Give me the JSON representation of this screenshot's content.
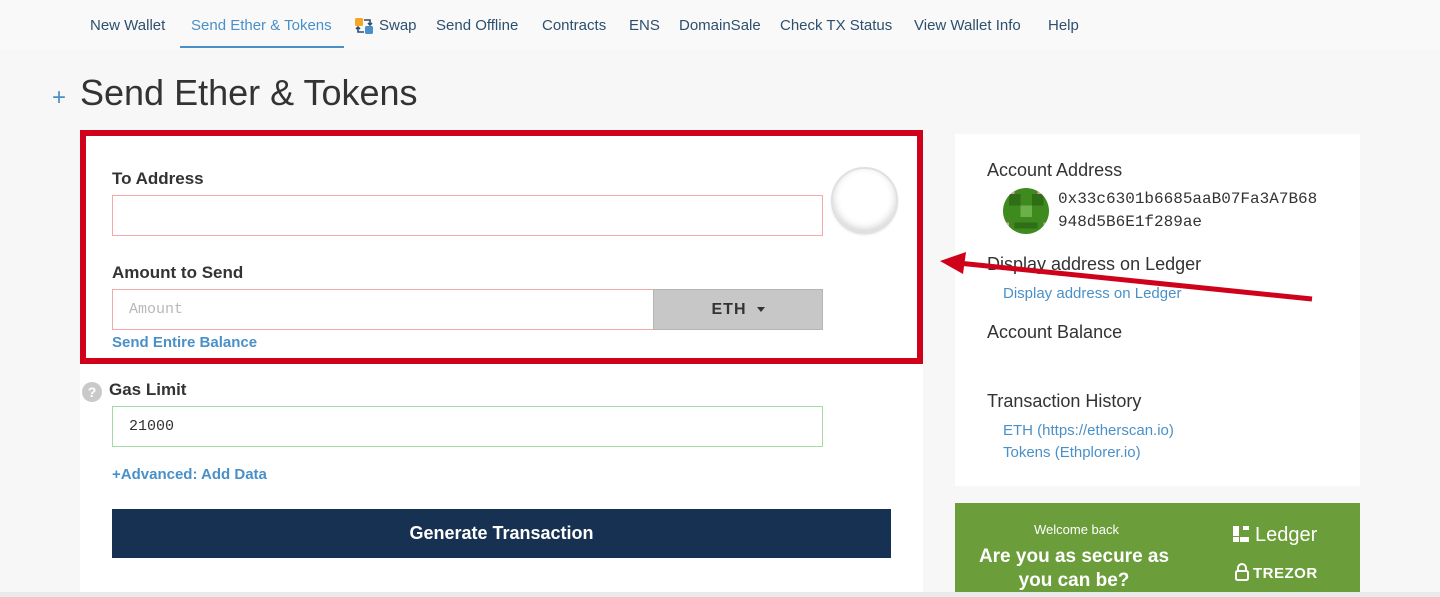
{
  "nav": {
    "items": [
      {
        "label": "New Wallet"
      },
      {
        "label": "Send Ether & Tokens"
      },
      {
        "label": "Swap"
      },
      {
        "label": "Send Offline"
      },
      {
        "label": "Contracts"
      },
      {
        "label": "ENS"
      },
      {
        "label": "DomainSale"
      },
      {
        "label": "Check TX Status"
      },
      {
        "label": "View Wallet Info"
      },
      {
        "label": "Help"
      }
    ],
    "active_index": 1
  },
  "page": {
    "plus": "+",
    "title": "Send Ether & Tokens"
  },
  "form": {
    "to_address_label": "To Address",
    "to_address_value": "",
    "amount_label": "Amount to Send",
    "amount_placeholder": "Amount",
    "unit": "ETH",
    "send_entire_balance": "Send Entire Balance",
    "gas_limit_label": "Gas Limit",
    "gas_limit_value": "21000",
    "help_glyph": "?",
    "advanced_link": "+Advanced: Add Data",
    "generate_button": "Generate Transaction"
  },
  "sidebar": {
    "account_address_label": "Account Address",
    "address_line1": "0x33c6301b6685aaB07Fa3A7B68",
    "address_line2": "948d5B6E1f289ae",
    "display_ledger_heading": "Display address on Ledger",
    "display_ledger_link": "Display address on Ledger",
    "account_balance_label": "Account Balance",
    "tx_history_label": "Transaction History",
    "tx_links": [
      "ETH (https://etherscan.io)",
      "Tokens (Ethplorer.io)"
    ]
  },
  "banner": {
    "small": "Welcome back",
    "big": "Are you as secure as you can be?",
    "brand1": "Ledger",
    "brand2": "TREZOR"
  },
  "colors": {
    "accent": "#4a90c8",
    "annotation_red": "#d0021b",
    "button_navy": "#163151",
    "banner_green": "#6b9d3a"
  },
  "icons": {
    "swap": "swap-icon",
    "help": "question-circle-icon",
    "caret": "caret-down-icon",
    "ledger": "ledger-logo-icon",
    "trezor": "lock-icon"
  }
}
